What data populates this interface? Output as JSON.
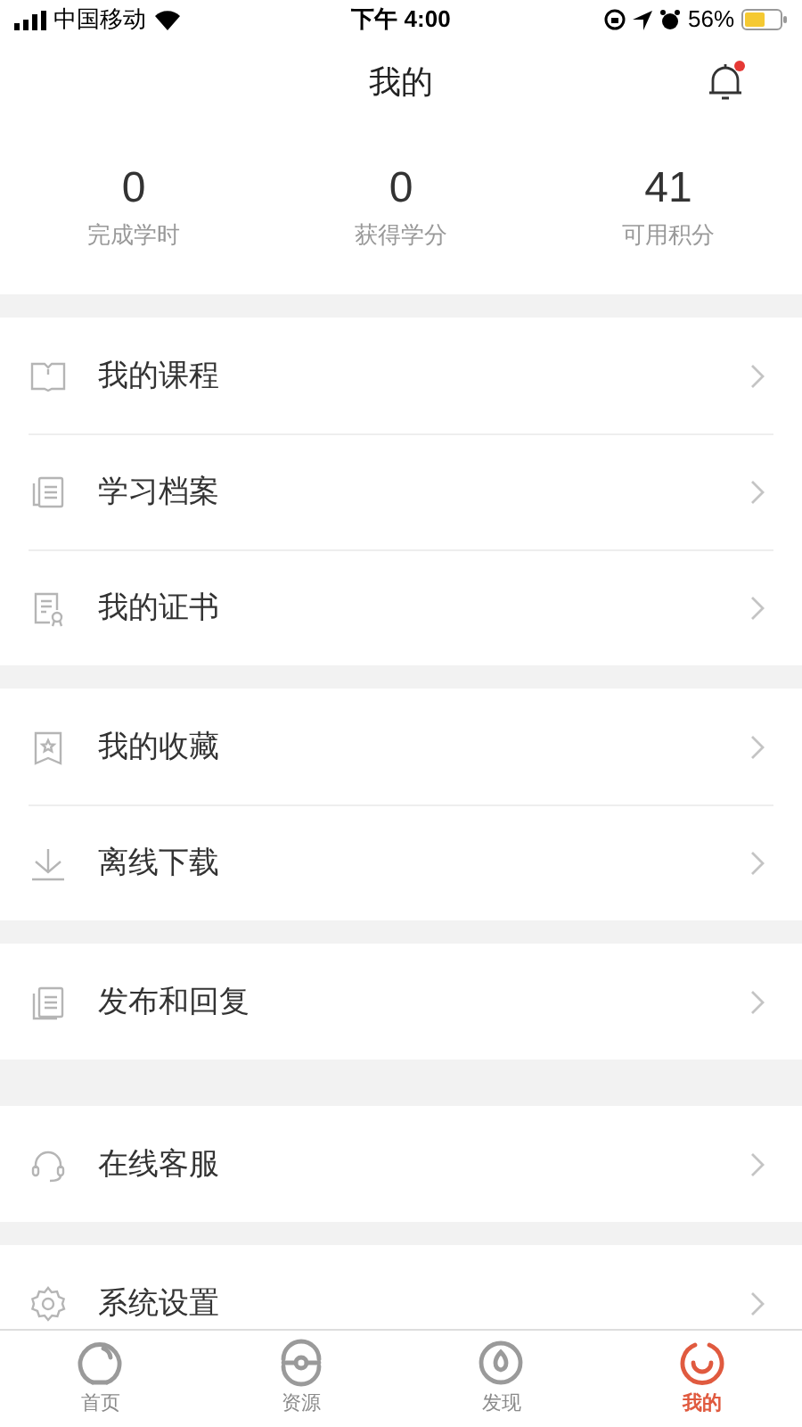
{
  "status_bar": {
    "carrier": "中国移动",
    "time": "下午 4:00",
    "battery": "56%"
  },
  "header": {
    "title": "我的",
    "has_notification": true
  },
  "stats": [
    {
      "value": "0",
      "label": "完成学时"
    },
    {
      "value": "0",
      "label": "获得学分"
    },
    {
      "value": "41",
      "label": "可用积分"
    }
  ],
  "groups": [
    {
      "items": [
        {
          "label": "我的课程"
        },
        {
          "label": "学习档案"
        },
        {
          "label": "我的证书"
        }
      ]
    },
    {
      "items": [
        {
          "label": "我的收藏"
        },
        {
          "label": "离线下载"
        }
      ]
    },
    {
      "items": [
        {
          "label": "发布和回复"
        }
      ]
    },
    {
      "items": [
        {
          "label": "在线客服"
        }
      ]
    },
    {
      "items": [
        {
          "label": "系统设置"
        }
      ]
    }
  ],
  "tab_bar": [
    {
      "label": "首页",
      "selected": false
    },
    {
      "label": "资源",
      "selected": false
    },
    {
      "label": "发现",
      "selected": false
    },
    {
      "label": "我的",
      "selected": true
    }
  ]
}
